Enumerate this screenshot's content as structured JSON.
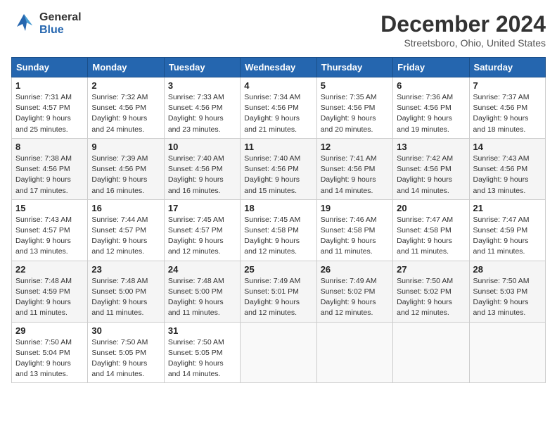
{
  "header": {
    "logo_general": "General",
    "logo_blue": "Blue",
    "month": "December 2024",
    "location": "Streetsboro, Ohio, United States"
  },
  "weekdays": [
    "Sunday",
    "Monday",
    "Tuesday",
    "Wednesday",
    "Thursday",
    "Friday",
    "Saturday"
  ],
  "weeks": [
    [
      {
        "day": "1",
        "sunrise": "7:31 AM",
        "sunset": "4:57 PM",
        "daylight": "9 hours and 25 minutes."
      },
      {
        "day": "2",
        "sunrise": "7:32 AM",
        "sunset": "4:56 PM",
        "daylight": "9 hours and 24 minutes."
      },
      {
        "day": "3",
        "sunrise": "7:33 AM",
        "sunset": "4:56 PM",
        "daylight": "9 hours and 23 minutes."
      },
      {
        "day": "4",
        "sunrise": "7:34 AM",
        "sunset": "4:56 PM",
        "daylight": "9 hours and 21 minutes."
      },
      {
        "day": "5",
        "sunrise": "7:35 AM",
        "sunset": "4:56 PM",
        "daylight": "9 hours and 20 minutes."
      },
      {
        "day": "6",
        "sunrise": "7:36 AM",
        "sunset": "4:56 PM",
        "daylight": "9 hours and 19 minutes."
      },
      {
        "day": "7",
        "sunrise": "7:37 AM",
        "sunset": "4:56 PM",
        "daylight": "9 hours and 18 minutes."
      }
    ],
    [
      {
        "day": "8",
        "sunrise": "7:38 AM",
        "sunset": "4:56 PM",
        "daylight": "9 hours and 17 minutes."
      },
      {
        "day": "9",
        "sunrise": "7:39 AM",
        "sunset": "4:56 PM",
        "daylight": "9 hours and 16 minutes."
      },
      {
        "day": "10",
        "sunrise": "7:40 AM",
        "sunset": "4:56 PM",
        "daylight": "9 hours and 16 minutes."
      },
      {
        "day": "11",
        "sunrise": "7:40 AM",
        "sunset": "4:56 PM",
        "daylight": "9 hours and 15 minutes."
      },
      {
        "day": "12",
        "sunrise": "7:41 AM",
        "sunset": "4:56 PM",
        "daylight": "9 hours and 14 minutes."
      },
      {
        "day": "13",
        "sunrise": "7:42 AM",
        "sunset": "4:56 PM",
        "daylight": "9 hours and 14 minutes."
      },
      {
        "day": "14",
        "sunrise": "7:43 AM",
        "sunset": "4:56 PM",
        "daylight": "9 hours and 13 minutes."
      }
    ],
    [
      {
        "day": "15",
        "sunrise": "7:43 AM",
        "sunset": "4:57 PM",
        "daylight": "9 hours and 13 minutes."
      },
      {
        "day": "16",
        "sunrise": "7:44 AM",
        "sunset": "4:57 PM",
        "daylight": "9 hours and 12 minutes."
      },
      {
        "day": "17",
        "sunrise": "7:45 AM",
        "sunset": "4:57 PM",
        "daylight": "9 hours and 12 minutes."
      },
      {
        "day": "18",
        "sunrise": "7:45 AM",
        "sunset": "4:58 PM",
        "daylight": "9 hours and 12 minutes."
      },
      {
        "day": "19",
        "sunrise": "7:46 AM",
        "sunset": "4:58 PM",
        "daylight": "9 hours and 11 minutes."
      },
      {
        "day": "20",
        "sunrise": "7:47 AM",
        "sunset": "4:58 PM",
        "daylight": "9 hours and 11 minutes."
      },
      {
        "day": "21",
        "sunrise": "7:47 AM",
        "sunset": "4:59 PM",
        "daylight": "9 hours and 11 minutes."
      }
    ],
    [
      {
        "day": "22",
        "sunrise": "7:48 AM",
        "sunset": "4:59 PM",
        "daylight": "9 hours and 11 minutes."
      },
      {
        "day": "23",
        "sunrise": "7:48 AM",
        "sunset": "5:00 PM",
        "daylight": "9 hours and 11 minutes."
      },
      {
        "day": "24",
        "sunrise": "7:48 AM",
        "sunset": "5:00 PM",
        "daylight": "9 hours and 11 minutes."
      },
      {
        "day": "25",
        "sunrise": "7:49 AM",
        "sunset": "5:01 PM",
        "daylight": "9 hours and 12 minutes."
      },
      {
        "day": "26",
        "sunrise": "7:49 AM",
        "sunset": "5:02 PM",
        "daylight": "9 hours and 12 minutes."
      },
      {
        "day": "27",
        "sunrise": "7:50 AM",
        "sunset": "5:02 PM",
        "daylight": "9 hours and 12 minutes."
      },
      {
        "day": "28",
        "sunrise": "7:50 AM",
        "sunset": "5:03 PM",
        "daylight": "9 hours and 13 minutes."
      }
    ],
    [
      {
        "day": "29",
        "sunrise": "7:50 AM",
        "sunset": "5:04 PM",
        "daylight": "9 hours and 13 minutes."
      },
      {
        "day": "30",
        "sunrise": "7:50 AM",
        "sunset": "5:05 PM",
        "daylight": "9 hours and 14 minutes."
      },
      {
        "day": "31",
        "sunrise": "7:50 AM",
        "sunset": "5:05 PM",
        "daylight": "9 hours and 14 minutes."
      },
      null,
      null,
      null,
      null
    ]
  ],
  "labels": {
    "sunrise": "Sunrise:",
    "sunset": "Sunset:",
    "daylight": "Daylight:"
  }
}
